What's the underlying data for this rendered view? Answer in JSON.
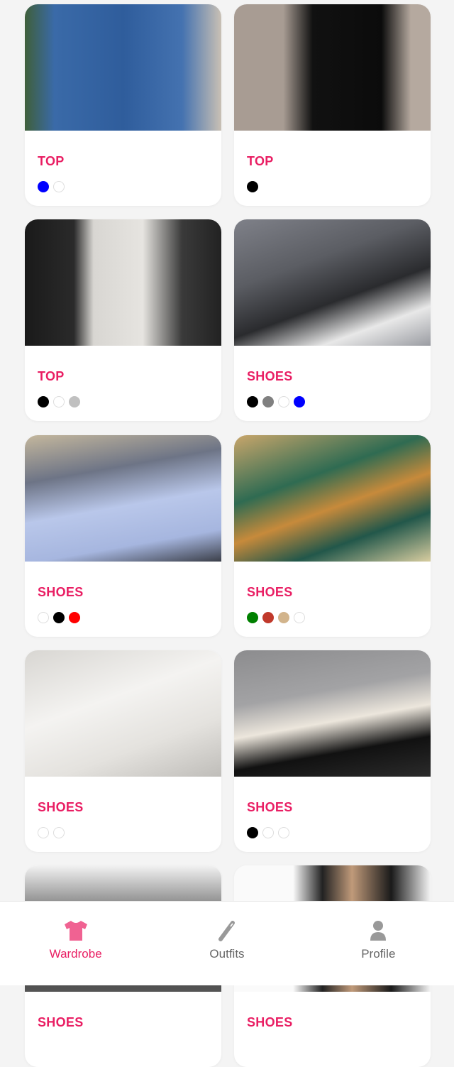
{
  "items": [
    {
      "category": "TOP",
      "colors": [
        "#0000ff",
        "#ffffff"
      ],
      "image": "denim-vest",
      "bg": "linear-gradient(90deg,#3f5f3a 0%,#3a6aa8 15%,#2f5d9c 50%,#4472b0 80%,#c9c0b4 100%)"
    },
    {
      "category": "TOP",
      "colors": [
        "#000000"
      ],
      "image": "black-dress",
      "bg": "linear-gradient(90deg,#a89c93 0%,#a89c93 25%,#111 40%,#0b0b0b 75%,#b5a99f 90%)"
    },
    {
      "category": "TOP",
      "colors": [
        "#000000",
        "#ffffff",
        "#c0c0c0"
      ],
      "image": "white-dress",
      "bg": "linear-gradient(90deg,#1a1a1a 0%,#2a2a2a 25%,#d8d6d2 35%,#e6e4e0 60%,#3a3a3a 80%,#222 100%)"
    },
    {
      "category": "SHOES",
      "colors": [
        "#000000",
        "#808080",
        "#ffffff",
        "#0000ff"
      ],
      "image": "grey-sneakers",
      "bg": "linear-gradient(160deg,#7f8189 0%,#5b5d63 35%,#2a2b2e 60%,#e8e8e8 80%,#9a9ca2 100%)"
    },
    {
      "category": "SHOES",
      "colors": [
        "#ffffff",
        "#000000",
        "#ff0000"
      ],
      "image": "white-nike-sneaker",
      "bg": "linear-gradient(170deg,#c4b79d 0%,#6d7486 30%,#b9c7ea 55%,#a6b6df 80%,#3b3f49 100%)"
    },
    {
      "category": "SHOES",
      "colors": [
        "#008000",
        "#c0392b",
        "#d2b48c",
        "#ffffff"
      ],
      "image": "green-brogues",
      "bg": "linear-gradient(160deg,#c9a66b 0%,#2f6b52 35%,#c78a3b 55%,#22574a 75%,#d8cda0 100%)"
    },
    {
      "category": "SHOES",
      "colors": [
        "#ffffff",
        "#ffffff"
      ],
      "image": "white-platform-sneaker",
      "bg": "linear-gradient(160deg,#d8d6d2 0%,#f4f3f1 40%,#e4e2de 70%,#bfbdb9 100%)"
    },
    {
      "category": "SHOES",
      "colors": [
        "#000000",
        "#ffffff",
        "#ffffff"
      ],
      "image": "black-white-platform",
      "bg": "linear-gradient(170deg,#8c8c8e 0%,#a3a3a5 35%,#ece6dc 55%,#111 75%,#2b2b2b 100%)"
    },
    {
      "category": "SHOES",
      "colors": [],
      "image": "black-oxfords",
      "bg": "linear-gradient(180deg,#f2f2f2 0%,#2a2a2a 60%,#555 100%)"
    },
    {
      "category": "SHOES",
      "colors": [],
      "image": "black-heels",
      "bg": "linear-gradient(90deg,#fafafa 0%,#fafafa 30%,#222 45%,#c09a7a 60%,#1a1a1a 80%,#f5f5f5 100%)"
    }
  ],
  "nav": {
    "active_color": "#e91e63",
    "items": [
      {
        "label": "Wardrobe",
        "icon": "tshirt-icon"
      },
      {
        "label": "Outfits",
        "icon": "pencil-icon"
      },
      {
        "label": "Profile",
        "icon": "person-icon"
      }
    ]
  }
}
